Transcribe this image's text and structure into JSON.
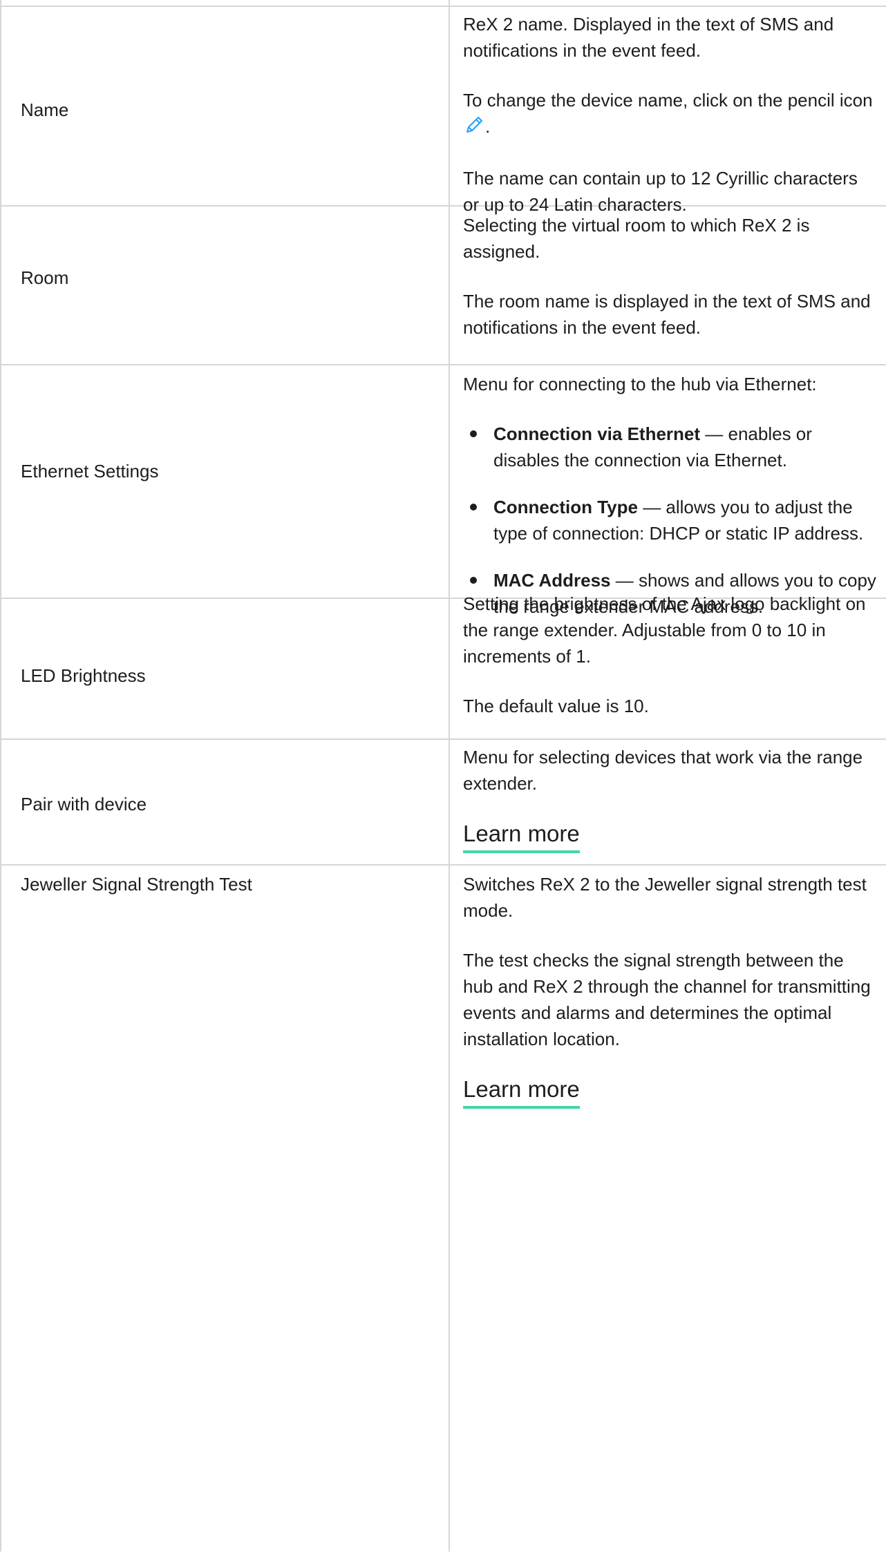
{
  "colors": {
    "border": "#d6d6d6",
    "text": "#1d1d1d",
    "link_underline": "#46d6a0",
    "pencil_icon": "#1ea0ff"
  },
  "rows": [
    {
      "label": "Name",
      "paragraphs": [
        "ReX 2 name. Displayed in the text of SMS and notifications in the event feed.",
        "To change the device name, click on the pencil icon",
        ".",
        "The name can contain up to 12 Cyrillic characters or up to 24 Latin characters."
      ],
      "icon": "pencil-icon"
    },
    {
      "label": "Room",
      "paragraphs": [
        "Selecting the virtual room to which ReX 2 is assigned.",
        "The room name is displayed in the text of SMS and notifications in the event feed."
      ]
    },
    {
      "label": "Ethernet Settings",
      "intro": "Menu for connecting to the hub via Ethernet:",
      "bullets": [
        {
          "term": "Connection via Ethernet",
          "text": " — enables or disables the connection via Ethernet."
        },
        {
          "term": "Connection Type",
          "text": " — allows you to adjust the type of connection: DHCP or static IP address."
        },
        {
          "term": "MAC Address",
          "text": " — shows and allows you to copy the range extender MAC address."
        }
      ]
    },
    {
      "label": "LED Brightness",
      "paragraphs": [
        "Setting the brightness of the Ajax logo backlight on the range extender. Adjustable from 0 to 10 in increments of 1.",
        "The default value is 10."
      ]
    },
    {
      "label": "Pair with device",
      "paragraphs": [
        "Menu for selecting devices that work via the range extender."
      ],
      "link": "Learn more"
    },
    {
      "label": "Jeweller Signal Strength Test",
      "paragraphs": [
        "Switches ReX 2 to the Jeweller signal strength test mode.",
        "The test checks the signal strength between the hub and ReX 2 through the channel for transmitting events and alarms and determines the optimal installation location."
      ],
      "link": "Learn more"
    }
  ]
}
